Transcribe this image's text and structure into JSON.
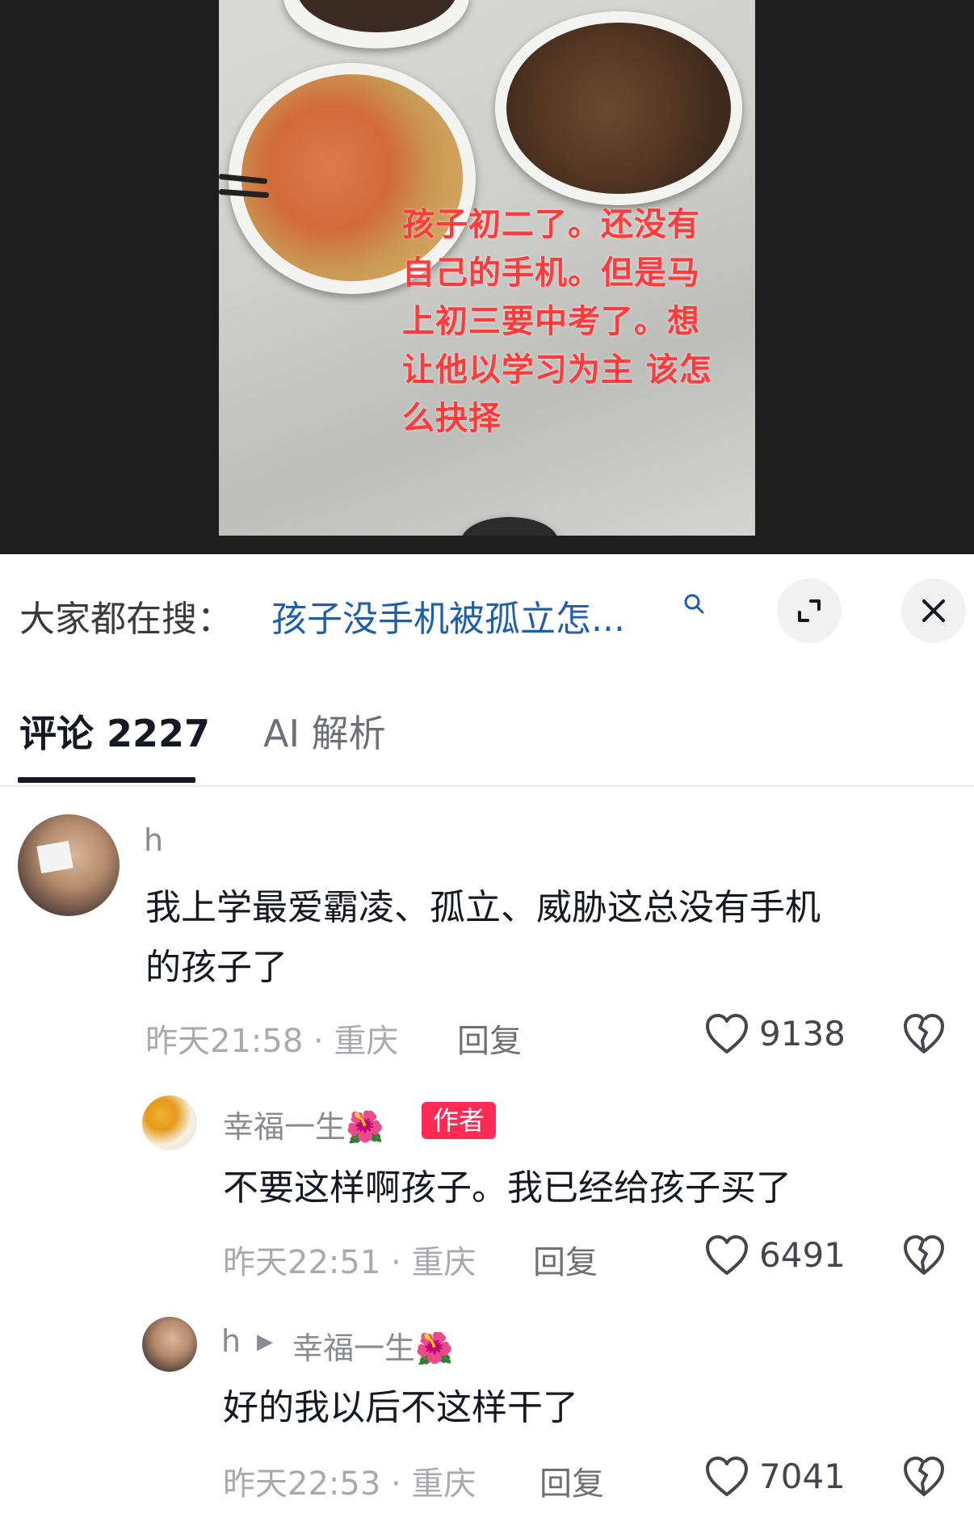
{
  "video": {
    "overlay_lines": [
      "孩子初二了。还没有",
      "自己的手机。但是马",
      "上初三要中考了。想",
      "让他以学习为主 该怎",
      "么抉择"
    ]
  },
  "search": {
    "prefix": "大家都在搜：",
    "query": "孩子没手机被孤立怎...",
    "icon": "search-icon",
    "accent_color": "#1f5fa8"
  },
  "tabs": [
    {
      "label": "评论 2227"
    },
    {
      "label": "AI 解析"
    }
  ],
  "comments": [
    {
      "user": "h",
      "text_lines": [
        "我上学最爱霸凌、孤立、威胁这总没有手机",
        "的孩子了"
      ],
      "time_location": "昨天21:58 · 重庆",
      "reply": "回复",
      "likes": "9138"
    },
    {
      "user": "幸福一生🌺",
      "badge": "作者",
      "text_lines": [
        "不要这样啊孩子。我已经给孩子买了"
      ],
      "time_location": "昨天22:51 · 重庆",
      "reply": "回复",
      "likes": "6491"
    },
    {
      "user": "h",
      "reply_to": "幸福一生🌺",
      "text_lines": [
        "好的我以后不这样干了"
      ],
      "time_location": "昨天22:53 · 重庆",
      "reply": "回复",
      "likes": "7041"
    }
  ],
  "colors": {
    "badge": "#fe2c55",
    "overlay_text": "#ff3b3b"
  }
}
